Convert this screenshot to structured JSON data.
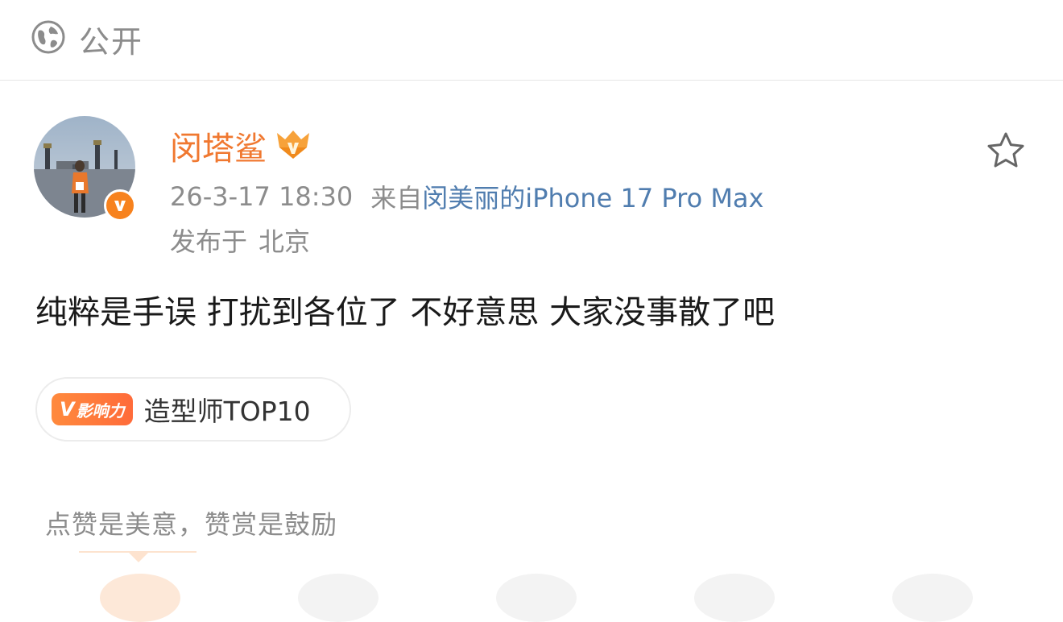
{
  "header": {
    "visibility_label": "公开",
    "visibility_icon": "globe-icon"
  },
  "post": {
    "author": "闵塔鲨",
    "author_badge_icon": "member-crown-icon",
    "verified_icon": "verified-v-icon",
    "time": "26-3-17 18:30",
    "source_prefix": "来自",
    "source_device": "闵美丽的iPhone 17 Pro Max",
    "location_prefix": "发布于",
    "location": "北京",
    "favorite_icon": "star-outline-icon",
    "text": "纯粹是手误 打扰到各位了 不好意思 大家没事散了吧"
  },
  "influence": {
    "tag_v": "V",
    "tag_label": "影响力",
    "label": "造型师TOP10"
  },
  "reward": {
    "tip": "点赞是美意，赞赏是鼓励"
  },
  "colors": {
    "accent_orange": "#f07830",
    "link_blue": "#507daf",
    "muted_gray": "#8c8c8c"
  }
}
